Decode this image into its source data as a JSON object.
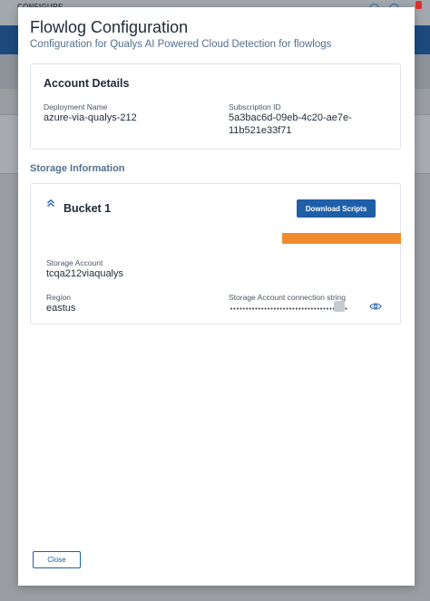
{
  "background": {
    "brand": "CONFIGURE"
  },
  "modal": {
    "title": "Flowlog Configuration",
    "subtitle": "Configuration for Qualys AI Powered Cloud Detection for flowlogs",
    "account": {
      "heading": "Account Details",
      "deployment_label": "Deployment Name",
      "deployment_value": "azure-via-qualys-212",
      "subscription_label": "Subscription ID",
      "subscription_value_line1": "5a3bac6d-09eb-4c20-ae7e-",
      "subscription_value_line2": "11b521e33f71"
    },
    "storage": {
      "section_title": "Storage Information",
      "bucket_title": "Bucket 1",
      "download_button": "Download Scripts",
      "storage_account_label": "Storage Account",
      "storage_account_value": "tcqa212viaqualys",
      "region_label": "Region",
      "region_value": "eastus",
      "connection_label": "Storage Account connection string",
      "connection_value_masked": "••••••••••••••••••••••••••••••••••••••••••••",
      "icons": {
        "collapse": "chevron-up-icon",
        "reveal": "eye-icon"
      }
    },
    "close_button": "Close"
  },
  "colors": {
    "primary": "#1e5fa8",
    "accent_orange": "#f28b2d",
    "subtitle": "#51708f",
    "header_blue": "#1c4a7e"
  }
}
